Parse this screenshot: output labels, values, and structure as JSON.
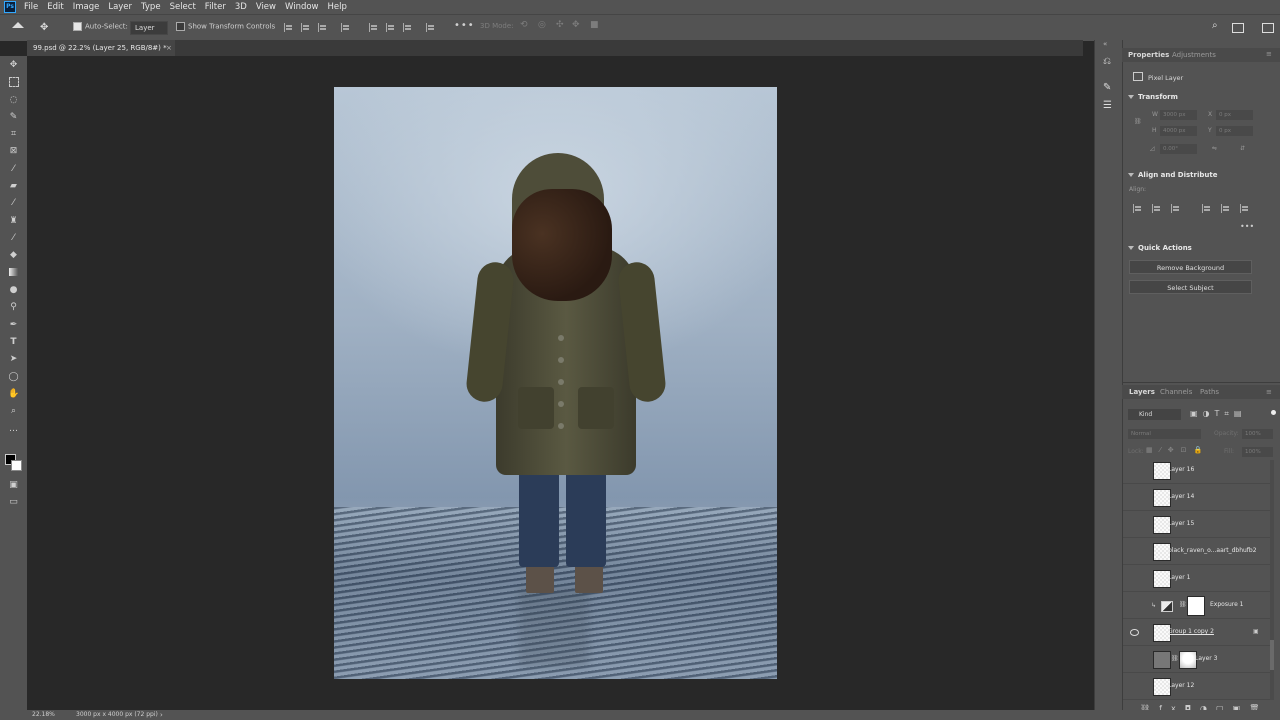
{
  "menu": [
    "File",
    "Edit",
    "Image",
    "Layer",
    "Type",
    "Select",
    "Filter",
    "3D",
    "View",
    "Window",
    "Help"
  ],
  "app_logo": "Ps",
  "options": {
    "auto_select_label": "Auto-Select:",
    "auto_select_target": "Layer",
    "transform_controls_label": "Show Transform Controls",
    "mode_3d": "3D Mode:"
  },
  "document_tab": "99.psd @ 22.2% (Layer 25, RGB/8#) *",
  "properties": {
    "tab_properties": "Properties",
    "tab_adjustments": "Adjustments",
    "layer_type": "Pixel Layer",
    "transform_title": "Transform",
    "w_label": "W",
    "w_value": "3000 px",
    "h_label": "H",
    "h_value": "4000 px",
    "x_label": "X",
    "x_value": "0 px",
    "y_label": "Y",
    "y_value": "0 px",
    "angle_value": "0.00°",
    "align_title": "Align and Distribute",
    "align_label": "Align:",
    "quick_actions_title": "Quick Actions",
    "remove_bg": "Remove Background",
    "select_subject": "Select Subject"
  },
  "layers_panel": {
    "tab_layers": "Layers",
    "tab_channels": "Channels",
    "tab_paths": "Paths",
    "kind": "Kind",
    "blend": "Normal",
    "opacity_label": "Opacity:",
    "opacity_value": "100%",
    "lock_label": "Lock:",
    "fill_label": "Fill:",
    "fill_value": "100%",
    "layers": [
      {
        "name": "Layer 16",
        "visible": false
      },
      {
        "name": "Layer 14",
        "visible": false
      },
      {
        "name": "Layer 15",
        "visible": false
      },
      {
        "name": "black_raven_o...aart_dbhufb2",
        "visible": false
      },
      {
        "name": "Layer 1",
        "visible": false
      },
      {
        "name": "Exposure 1",
        "visible": false
      },
      {
        "name": "Group 1 copy 2",
        "visible": true
      },
      {
        "name": "Layer 3",
        "visible": false
      },
      {
        "name": "Layer 12",
        "visible": false
      }
    ]
  },
  "status": {
    "zoom": "22.18%",
    "doc_info": "3000 px x 4000 px (72 ppi)"
  },
  "colors": {
    "chrome": "#535353",
    "workspace": "#282828",
    "accent": "#31a8ff"
  }
}
